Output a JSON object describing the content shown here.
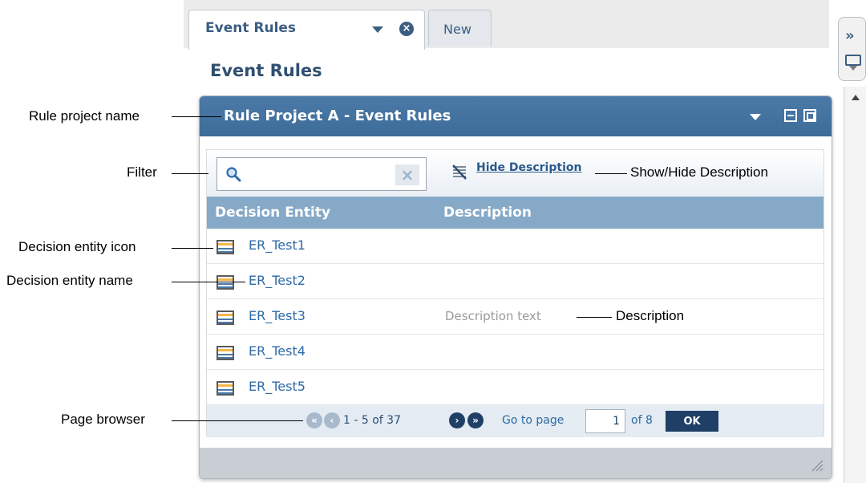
{
  "tabs": [
    {
      "label": "Event Rules",
      "active": true
    },
    {
      "label": "New",
      "active": false
    }
  ],
  "page": {
    "title": "Event Rules"
  },
  "portlet": {
    "title": "Rule Project A - Event Rules"
  },
  "toolbar": {
    "filter_value": "",
    "hide_description_label": "Hide Description"
  },
  "grid": {
    "columns": [
      "Decision Entity",
      "Description"
    ],
    "rows": [
      {
        "name": "ER_Test1",
        "description": ""
      },
      {
        "name": "ER_Test2",
        "description": ""
      },
      {
        "name": "ER_Test3",
        "description": "Description text"
      },
      {
        "name": "ER_Test4",
        "description": ""
      },
      {
        "name": "ER_Test5",
        "description": ""
      }
    ]
  },
  "pager": {
    "range": "1 - 5 of 37",
    "goto_label": "Go to page",
    "current_page": "1",
    "of_pages": "of 8",
    "ok_label": "OK"
  },
  "annotations": {
    "rule_project_name": "Rule project name",
    "filter": "Filter",
    "show_hide_description": "Show/Hide Description",
    "decision_entity_icon": "Decision entity icon",
    "decision_entity_name": "Decision entity name",
    "description": "Description",
    "page_browser": "Page browser"
  },
  "colors": {
    "header_blue": "#3d6c99",
    "grid_header": "#86a9c7",
    "link_blue": "#2e6aa6",
    "dark_navy": "#1f3f66"
  }
}
